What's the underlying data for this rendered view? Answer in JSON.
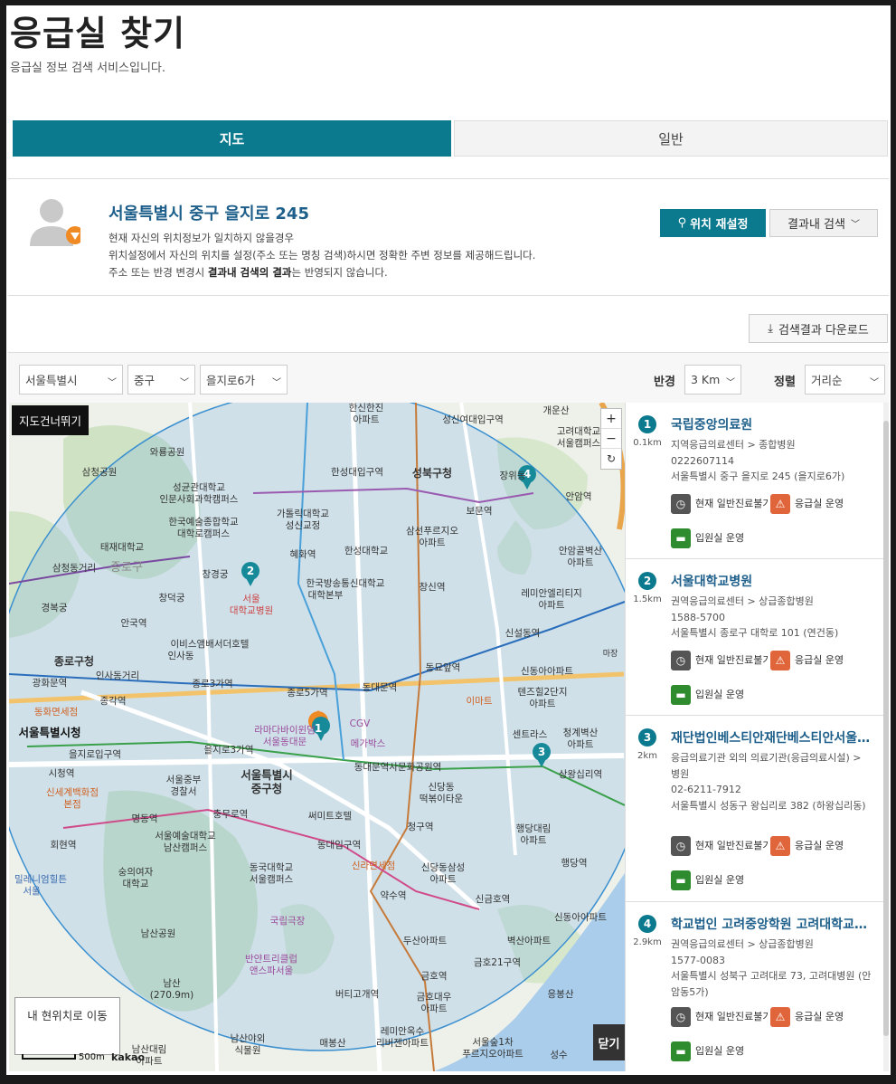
{
  "header": {
    "title": "응급실 찾기",
    "subtitle": "응급실 정보 검색 서비스입니다."
  },
  "tabs": [
    {
      "label": "지도",
      "active": true
    },
    {
      "label": "일반",
      "active": false
    }
  ],
  "location": {
    "address": "서울특별시 중구 을지로 245",
    "desc_line1": "현재 자신의 위치정보가 일치하지 않을경우",
    "desc_line2": "위치설정에서 자신의 위치를 설정(주소 또는 명칭 검색)하시면 정확한 주변 정보를 제공해드립니다.",
    "desc_line3_pre": "주소 또는 반경 변경시 ",
    "desc_line3_bold": "결과내 검색의 결과",
    "desc_line3_post": "는 반영되지 않습니다.",
    "reset_button": "위치 재설정",
    "search_in_results": "결과내 검색"
  },
  "download_button": "검색결과 다운로드",
  "filters": {
    "city": "서울특별시",
    "district": "중구",
    "dong": "을지로6가",
    "radius_label": "반경",
    "radius_value": "3 Km",
    "sort_label": "정렬",
    "sort_value": "거리순"
  },
  "map": {
    "skip_label": "지도건너뛰기",
    "zoom_in": "+",
    "zoom_out": "−",
    "refresh": "↻",
    "my_location": "내 현위치로 이동",
    "close": "닫기",
    "scale": "500m",
    "provider": "kakao",
    "labels": {
      "l1": "한신한진",
      "l2": "아파트",
      "l3": "성신여대입구역",
      "l4": "개운산",
      "l5": "고려대학교",
      "l6": "서울캠퍼스",
      "l7": "와룡공원",
      "l8": "삼청공원",
      "l9": "성균관대학교",
      "l10": "인문사회과학캠퍼스",
      "l11": "한성대입구역",
      "l12": "성북구청",
      "l13": "장위동",
      "l14": "안암역",
      "l15": "가톨릭대학교",
      "l16": "성신교정",
      "l17": "보문역",
      "l18": "한국예술종합학교",
      "l19": "대학로캠퍼스",
      "l20": "삼선푸르지오",
      "l21": "태재대학교",
      "l22": "혜화역",
      "l23": "한성대학교",
      "l24": "안암골벽산",
      "l25": "삼청동거리",
      "l26": "종로구",
      "l27": "창경궁",
      "l28": "서울",
      "l29": "대학교병원",
      "l30": "한국방송통신대학교",
      "l31": "대학본부",
      "l32": "창신역",
      "l33": "레미안엘리티지",
      "l34": "창덕궁",
      "l35": "경복궁",
      "l36": "안국역",
      "l37": "신설동역",
      "l38": "종로구청",
      "l39": "이비스앰배서더호텔",
      "l40": "인사동",
      "l41": "인사동거리",
      "l42": "광화문역",
      "l43": "동묘앞역",
      "l44": "신동아아파트",
      "l45": "종로3가역",
      "l46": "종로5가역",
      "l47": "동대문역",
      "l48": "종각역",
      "l49": "동화면세점",
      "l50": "이마트",
      "l51": "텐즈힐2단지",
      "l52": "라마다바이윈덤",
      "l53": "서울동대문",
      "l54": "CGV",
      "l55": "서울특별시청",
      "l56": "메가박스",
      "l57": "센트라스",
      "l58": "청계벽산",
      "l59": "을지로입구역",
      "l60": "을지로3가역",
      "l61": "동대문역사문화공원역",
      "l62": "상왕십리역",
      "l63": "시청역",
      "l64": "서울중부",
      "l65": "경찰서",
      "l66": "서울특별시",
      "l67": "중구청",
      "l68": "신당동",
      "l69": "떡볶이타운",
      "l70": "신세계백화점",
      "l71": "본점",
      "l72": "명동역",
      "l73": "충무로역",
      "l74": "써미트호텔",
      "l75": "청구역",
      "l76": "행당대림",
      "l77": "회현역",
      "l78": "서울예술대학교",
      "l79": "남산캠퍼스",
      "l80": "동대입구역",
      "l81": "행당역",
      "l82": "숭의여자",
      "l83": "대학교",
      "l84": "동국대학교",
      "l85": "서울캠퍼스",
      "l86": "신라면세점",
      "l87": "신당동삼성",
      "l88": "밀레니엄힐튼",
      "l89": "약수역",
      "l90": "신금호역",
      "l91": "남산공원",
      "l92": "국립극장",
      "l93": "두산아파트",
      "l94": "벽산아파트",
      "l95": "신동아아파트",
      "l96": "반얀트리클럽",
      "l97": "앤스파서울",
      "l98": "금호21구역",
      "l99": "남산",
      "l100": "(270.9m)",
      "l101": "버티고개역",
      "l102": "금호역",
      "l103": "응봉산",
      "l104": "금호대우",
      "l105": "남산대림",
      "l106": "남산야외",
      "l107": "식물원",
      "l108": "레미안옥수",
      "l109": "리버젠아파트",
      "l110": "매봉산",
      "l111": "서울숲1차",
      "l112": "푸르지오아파트",
      "l113": "성수",
      "l114": "마장",
      "l115": "금호"
    }
  },
  "results": [
    {
      "num": "1",
      "dist": "0.1km",
      "name": "국립중앙의료원",
      "category": "지역응급의료센터 > 종합병원",
      "phone": "0222607114",
      "address": "서울특별시 중구 을지로 245 (을지로6가)",
      "status_general": "현재 일반진료불가",
      "status_er": "응급실 운영",
      "status_ward": "입원실 운영"
    },
    {
      "num": "2",
      "dist": "1.5km",
      "name": "서울대학교병원",
      "category": "권역응급의료센터 > 상급종합병원",
      "phone": "1588-5700",
      "address": "서울특별시 종로구 대학로 101 (연건동)",
      "status_general": "현재 일반진료불가",
      "status_er": "응급실 운영",
      "status_ward": "입원실 운영"
    },
    {
      "num": "3",
      "dist": "2km",
      "name": "재단법인베스티안재단베스티안서울병원",
      "category": "응급의료기관 외의 의료기관(응급의료시설) > 병원",
      "phone": "02-6211-7912",
      "address": "서울특별시 성동구 왕십리로 382 (하왕십리동)",
      "status_general": "현재 일반진료불가",
      "status_er": "응급실 운영",
      "status_ward": "입원실 운영"
    },
    {
      "num": "4",
      "dist": "2.9km",
      "name": "학교법인 고려중앙학원 고려대학교의과대학부속병원(안암병원)",
      "category": "권역응급의료센터 > 상급종합병원",
      "phone": "1577-0083",
      "address": "서울특별시 성북구 고려대로 73, 고려대병원 (안암동5가)",
      "status_general": "현재 일반진료불가",
      "status_er": "응급실 운영",
      "status_ward": "입원실 운영"
    }
  ],
  "colors": {
    "primary": "#0b7a8f",
    "link": "#1d5f8a",
    "er_icon": "#e0653a",
    "ward_icon": "#2e8b2e"
  }
}
